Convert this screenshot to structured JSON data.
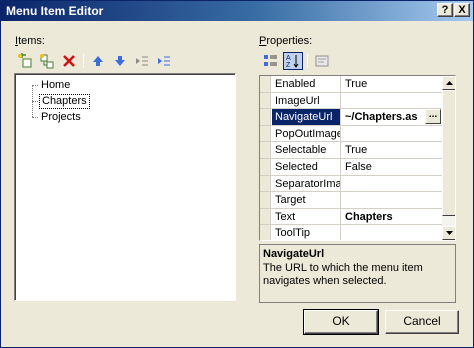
{
  "window": {
    "title": "Menu Item Editor",
    "help_glyph": "?",
    "close_glyph": "X"
  },
  "items_pane": {
    "label": "Items:",
    "toolbar": [
      "add-root-item-icon",
      "add-child-item-icon",
      "delete-item-icon",
      "move-up-icon",
      "move-down-icon",
      "outdent-icon",
      "indent-icon"
    ],
    "tree": [
      {
        "label": "Home"
      },
      {
        "label": "Chapters",
        "selected": true
      },
      {
        "label": "Projects"
      }
    ]
  },
  "properties_pane": {
    "label": "Properties:",
    "toolbar": [
      "categorized-icon",
      "alphabetical-icon",
      "property-pages-icon"
    ],
    "rows": [
      {
        "name": "Enabled",
        "value": "True"
      },
      {
        "name": "ImageUrl",
        "value": ""
      },
      {
        "name": "NavigateUrl",
        "value": "~/Chapters.as",
        "selected": true,
        "bold": true,
        "ellipsis": "..."
      },
      {
        "name": "PopOutImage",
        "value": ""
      },
      {
        "name": "Selectable",
        "value": "True"
      },
      {
        "name": "Selected",
        "value": "False"
      },
      {
        "name": "SeparatorIma",
        "value": ""
      },
      {
        "name": "Target",
        "value": ""
      },
      {
        "name": "Text",
        "value": "Chapters",
        "bold": true
      },
      {
        "name": "ToolTip",
        "value": ""
      }
    ],
    "description": {
      "title": "NavigateUrl",
      "text": "The URL to which the menu item navigates when selected."
    }
  },
  "buttons": {
    "ok": "OK",
    "cancel": "Cancel"
  },
  "colors": {
    "titlebar_start": "#0a246a",
    "selection": "#0a246a",
    "face": "#ece9d8"
  }
}
